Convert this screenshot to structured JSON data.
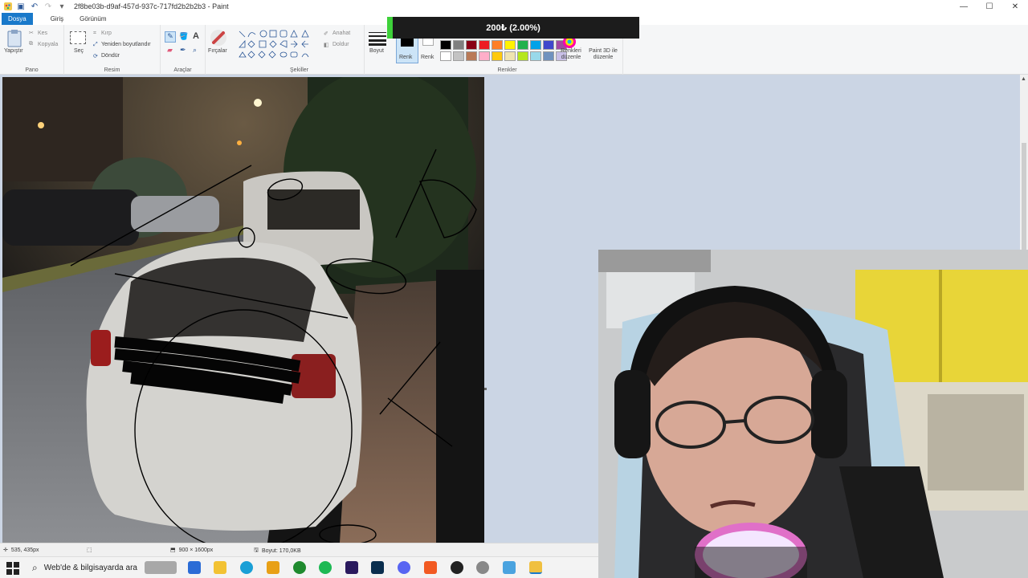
{
  "window": {
    "title": "2f8be03b-d9af-457d-937c-717fd2b2b2b3 - Paint",
    "controls": {
      "minimize": "—",
      "maximize": "☐",
      "close": "✕"
    }
  },
  "menu": {
    "file": "Dosya",
    "home": "Giriş",
    "view": "Görünüm"
  },
  "overlay": {
    "text": "200₺ (2.00%)"
  },
  "ribbon": {
    "clipboard": {
      "label": "Pano",
      "paste": "Yapıştır",
      "cut": "Kes",
      "copy": "Kopyala"
    },
    "image": {
      "label": "Resim",
      "select": "Seç",
      "crop": "Kırp",
      "resize": "Yeniden boyutlandır",
      "rotate": "Döndür"
    },
    "tools": {
      "label": "Araçlar"
    },
    "brushes": {
      "label": "Fırçalar"
    },
    "shapes": {
      "label": "Şekiller",
      "outline": "Anahat",
      "fill": "Doldur"
    },
    "size": {
      "label": "Boyut"
    },
    "colors": {
      "label": "Renkler",
      "color1": "Renk",
      "color2": "Renk",
      "edit": "Renkleri düzenle",
      "paint3d": "Paint 3D ile düzenle"
    }
  },
  "palette": [
    "#000000",
    "#7f7f7f",
    "#880015",
    "#ed1c24",
    "#ff7f27",
    "#fff200",
    "#22b14c",
    "#00a2e8",
    "#3f48cc",
    "#a349a4",
    "#ffffff",
    "#c3c3c3",
    "#b97a57",
    "#ffaec9",
    "#ffc90e",
    "#efe4b0",
    "#b5e61d",
    "#99d9ea",
    "#7092be",
    "#c8bfe7"
  ],
  "status": {
    "cursor": "535, 435px",
    "dimensions": "900 × 1600px",
    "filesize": "Boyut: 170,0KB"
  },
  "taskbar": {
    "search_placeholder": "Web'de & bilgisayarda ara"
  },
  "colors": {
    "accent": "#1979ca",
    "workspace": "#cbd5e4",
    "overlay": "#1c1c1c",
    "overlay_bar": "#3ed13a"
  }
}
